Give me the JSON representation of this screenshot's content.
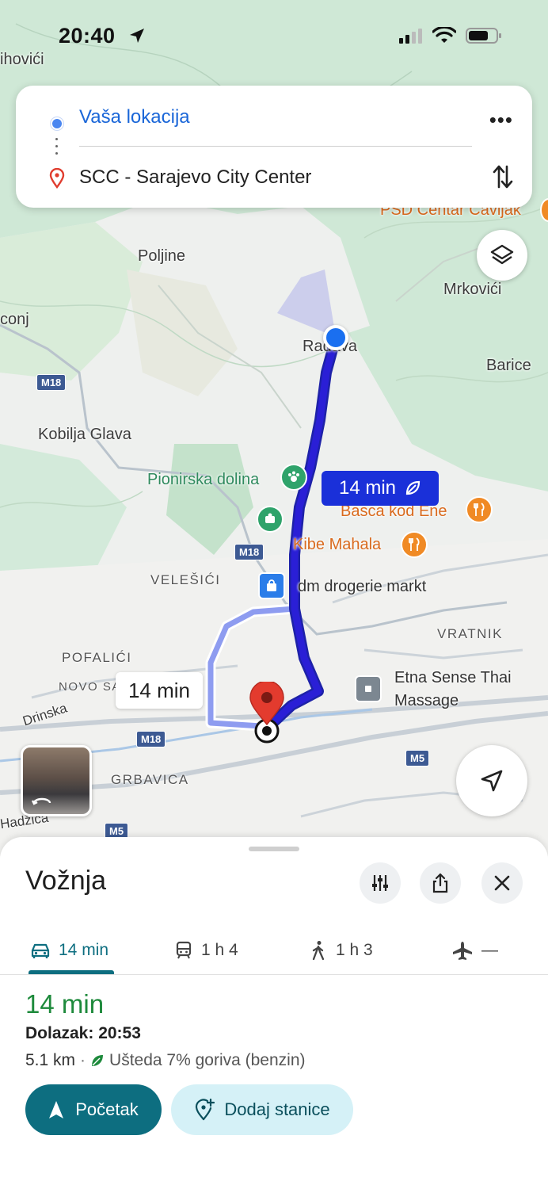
{
  "status_bar": {
    "time": "20:40"
  },
  "route_card": {
    "origin": "Vaša lokacija",
    "destination": "SCC - Sarajevo City Center",
    "more_label": "•••"
  },
  "map": {
    "labels": {
      "ihovici": "ihovići",
      "psd": "PSD Centar Ćavljak",
      "poljine": "Poljine",
      "mrkovici": "Mrkovići",
      "conj": "conj",
      "radava": "Radava",
      "barice": "Barice",
      "kobilja": "Kobilja Glava",
      "pionirska": "Pionirska dolina",
      "basca": "Basca kod Ene",
      "kibe": "Kibe Mahala",
      "velesici": "VELEŠIĆI",
      "dm": "dm drogerie markt",
      "vratnik": "VRATNIK",
      "pofalici": "POFALIĆI",
      "novo_sa": "NOVO SA",
      "etna1": "Etna Sense Thai",
      "etna2": "Massage",
      "drinska": "Drinska",
      "grbavica": "GRBAVICA",
      "hadzica": "Hadžića"
    },
    "shields": {
      "m18a": "M18",
      "m18b": "M18",
      "m18c": "M18",
      "m5a": "M5",
      "m5b": "M5"
    },
    "route_badge_primary": "14 min",
    "route_badge_alt": "14 min"
  },
  "sheet": {
    "title": "Vožnja",
    "tabs": [
      {
        "label": "14 min",
        "icon": "car-icon"
      },
      {
        "label": "1 h 4",
        "icon": "transit-icon"
      },
      {
        "label": "1 h 3",
        "icon": "walk-icon"
      },
      {
        "label": "—",
        "icon": "plane-icon"
      }
    ],
    "eta": "14 min",
    "arrival": "Dolazak: 20:53",
    "distance": "5.1 km",
    "separator": "·",
    "eco": "Ušteda 7% goriva (benzin)",
    "start_label": "Početak",
    "add_stops_label": "Dodaj stanice"
  },
  "colors": {
    "route": "#2a1fd6",
    "route_alt": "#8e9cf0",
    "accent_teal": "#0d6e80",
    "eta_green": "#1e8a3c",
    "origin_blue": "#1a66d8"
  }
}
